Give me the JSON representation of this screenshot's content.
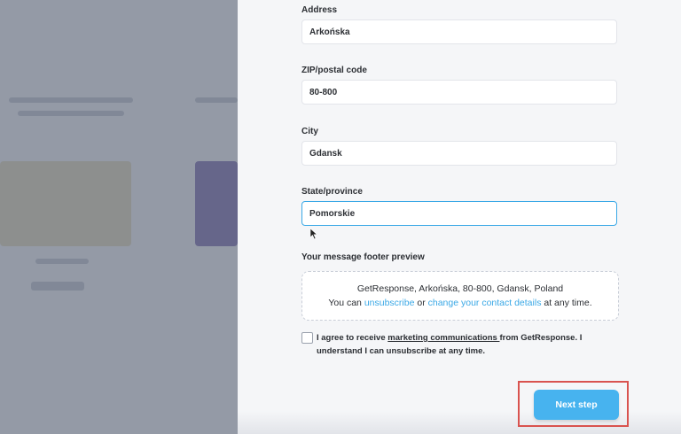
{
  "form": {
    "address_label": "Address",
    "address_value": "Arkońska",
    "zip_label": "ZIP/postal code",
    "zip_value": "80-800",
    "city_label": "City",
    "city_value": "Gdansk",
    "state_label": "State/province",
    "state_value": "Pomorskie"
  },
  "preview": {
    "title": "Your message footer preview",
    "line1": "GetResponse, Arkońska, 80-800, Gdansk, Poland",
    "line2_prefix": "You can ",
    "unsubscribe": "unsubscribe",
    "or": " or ",
    "change_details": "change your contact details",
    "line2_suffix": " at any time."
  },
  "consent": {
    "prefix": "I agree to receive ",
    "link": "marketing communications ",
    "suffix": "from GetResponse. I understand I can unsubscribe at any time."
  },
  "actions": {
    "next_label": "Next step"
  },
  "colors": {
    "accent": "#47b3ef",
    "link": "#3aa8e6",
    "highlight": "#d9534f"
  }
}
